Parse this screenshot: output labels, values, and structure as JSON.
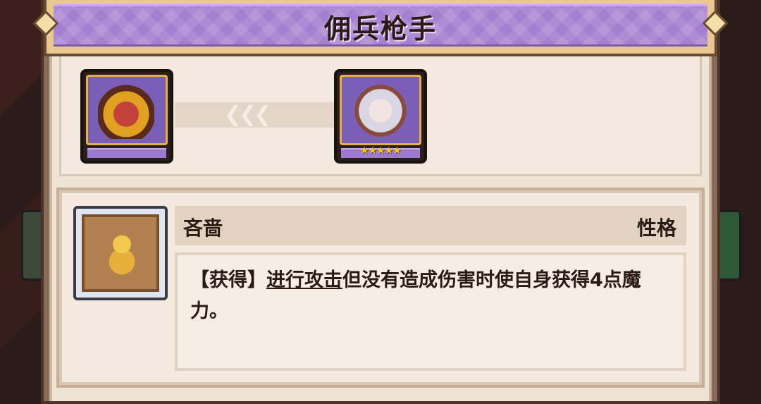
{
  "title": "佣兵枪手",
  "evolution": {
    "from_portrait_icon": "mercenary-demon-portrait",
    "to_portrait_icon": "mercenary-white-hair-portrait",
    "arrows": "❮❮❮",
    "to_stars": "★★★★★",
    "to_star_count": 5
  },
  "trait": {
    "icon": "trait-emblem-icon",
    "name": "吝啬",
    "category": "性格",
    "desc_prefix": "【获得】",
    "desc_keyword": "进行攻击",
    "desc_rest": "但没有造成伤害时使自身获得4点魔力。"
  },
  "colors": {
    "banner_purple": "#a57fd0",
    "panel_bg": "#efe3d5",
    "frame_gold": "#e8b03a",
    "star_yellow": "#f6c81e"
  }
}
